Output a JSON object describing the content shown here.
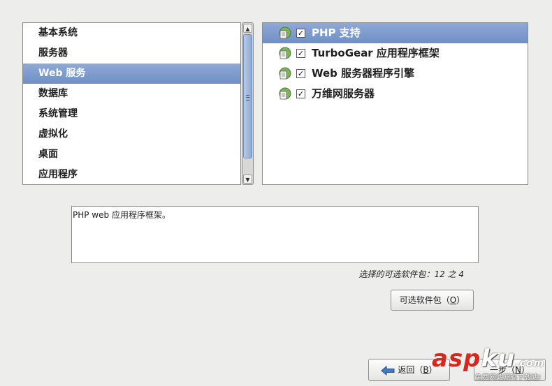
{
  "categories": {
    "items": [
      {
        "label": "基本系统"
      },
      {
        "label": "服务器"
      },
      {
        "label": "Web 服务",
        "selected": true
      },
      {
        "label": "数据库"
      },
      {
        "label": "系统管理"
      },
      {
        "label": "虚拟化"
      },
      {
        "label": "桌面"
      },
      {
        "label": "应用程序"
      }
    ]
  },
  "packages": {
    "items": [
      {
        "label": "PHP 支持",
        "checked": true,
        "selected": true,
        "icon": "package-icon"
      },
      {
        "label": "TurboGear 应用程序框架",
        "checked": true,
        "icon": "package-icon"
      },
      {
        "label": "Web 服务器程序引擎",
        "checked": true,
        "icon": "package-icon"
      },
      {
        "label": "万维网服务器",
        "checked": true,
        "icon": "package-icon"
      }
    ]
  },
  "description": {
    "text": "PHP web 应用程序框架。"
  },
  "selected_count": {
    "text": "选择的可选软件包：12 之 4"
  },
  "buttons": {
    "optional_packages": {
      "label": "可选软件包（",
      "mnemonic": "O",
      "suffix": "）"
    },
    "back": {
      "label": "返回（",
      "mnemonic": "B",
      "suffix": "）"
    },
    "next": {
      "label": "一步（",
      "mnemonic": "N",
      "suffix": "）"
    }
  },
  "watermark": {
    "logo_main": "asp",
    "logo_accent": "ku",
    "logo_tld": ".com",
    "subtitle": "免费网站源码下载站!"
  },
  "colors": {
    "selection": "#7a97cb",
    "background": "#ededec",
    "watermark": "#d8281e"
  }
}
